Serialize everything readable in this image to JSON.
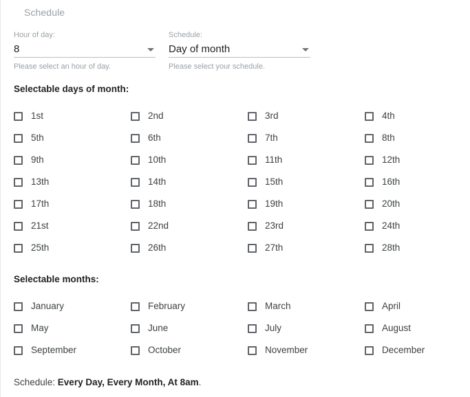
{
  "panel": {
    "header": "Schedule"
  },
  "fields": [
    {
      "label": "Hour of day:",
      "value": "8",
      "hint": "Please select an hour of day.",
      "name": "hour-of-day"
    },
    {
      "label": "Schedule:",
      "value": "Day of month",
      "hint": "Please select your schedule.",
      "name": "schedule-type"
    }
  ],
  "days_section": {
    "title": "Selectable days of month:",
    "items": [
      "1st",
      "2nd",
      "3rd",
      "4th",
      "5th",
      "6th",
      "7th",
      "8th",
      "9th",
      "10th",
      "11th",
      "12th",
      "13th",
      "14th",
      "15th",
      "16th",
      "17th",
      "18th",
      "19th",
      "20th",
      "21st",
      "22nd",
      "23rd",
      "24th",
      "25th",
      "26th",
      "27th",
      "28th"
    ],
    "checked": []
  },
  "months_section": {
    "title": "Selectable months:",
    "items": [
      "January",
      "February",
      "March",
      "April",
      "May",
      "June",
      "July",
      "August",
      "September",
      "October",
      "November",
      "December"
    ],
    "checked": []
  },
  "summary": {
    "prefix": "Schedule: ",
    "value": "Every Day, Every Month, At 8am",
    "suffix": "."
  },
  "colors": {
    "text_primary": "#202124",
    "text_secondary": "#3c4043",
    "text_muted": "#9aa0a6",
    "checkbox_border": "#5f6368",
    "underline": "#bdbdbd",
    "panel_border": "#e8e8e8",
    "background": "#ffffff"
  },
  "icons": {
    "caret": "chevron-down-icon"
  }
}
